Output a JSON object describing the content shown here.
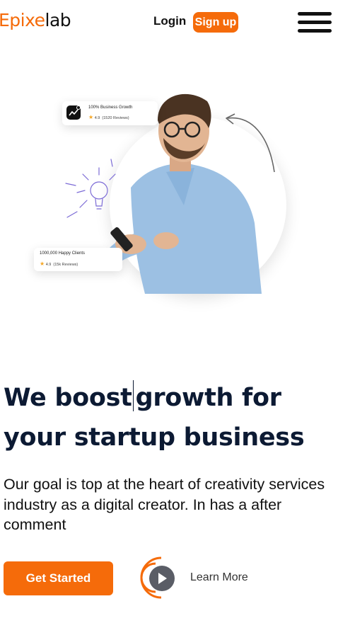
{
  "brand": {
    "logo_part1": "Epixe",
    "logo_part2": "lab"
  },
  "nav": {
    "login_label": "Login",
    "signup_label": "Sign up"
  },
  "hero": {
    "card_top": {
      "title": "100% Business Growth",
      "rating": "4.9",
      "reviews": "(1520 Reviews)"
    },
    "card_bottom": {
      "title": "1000,000 Happy Clients",
      "rating": "4.9",
      "reviews": "(15k Reviews)"
    }
  },
  "headline": {
    "line1_a": "We boost",
    "line1_b": "growth for",
    "line2": "your startup business"
  },
  "description": "Our goal is top at the heart of creativity services industry as a digital creator. In has a after comment",
  "cta": {
    "primary_label": "Get Started",
    "secondary_label": "Learn More"
  },
  "colors": {
    "accent": "#f56b0a",
    "heading": "#0c1a33"
  },
  "icons": [
    "menu-icon",
    "trend-chart-icon",
    "star-icon",
    "lightbulb-icon",
    "curved-arrow-icon",
    "play-icon"
  ]
}
